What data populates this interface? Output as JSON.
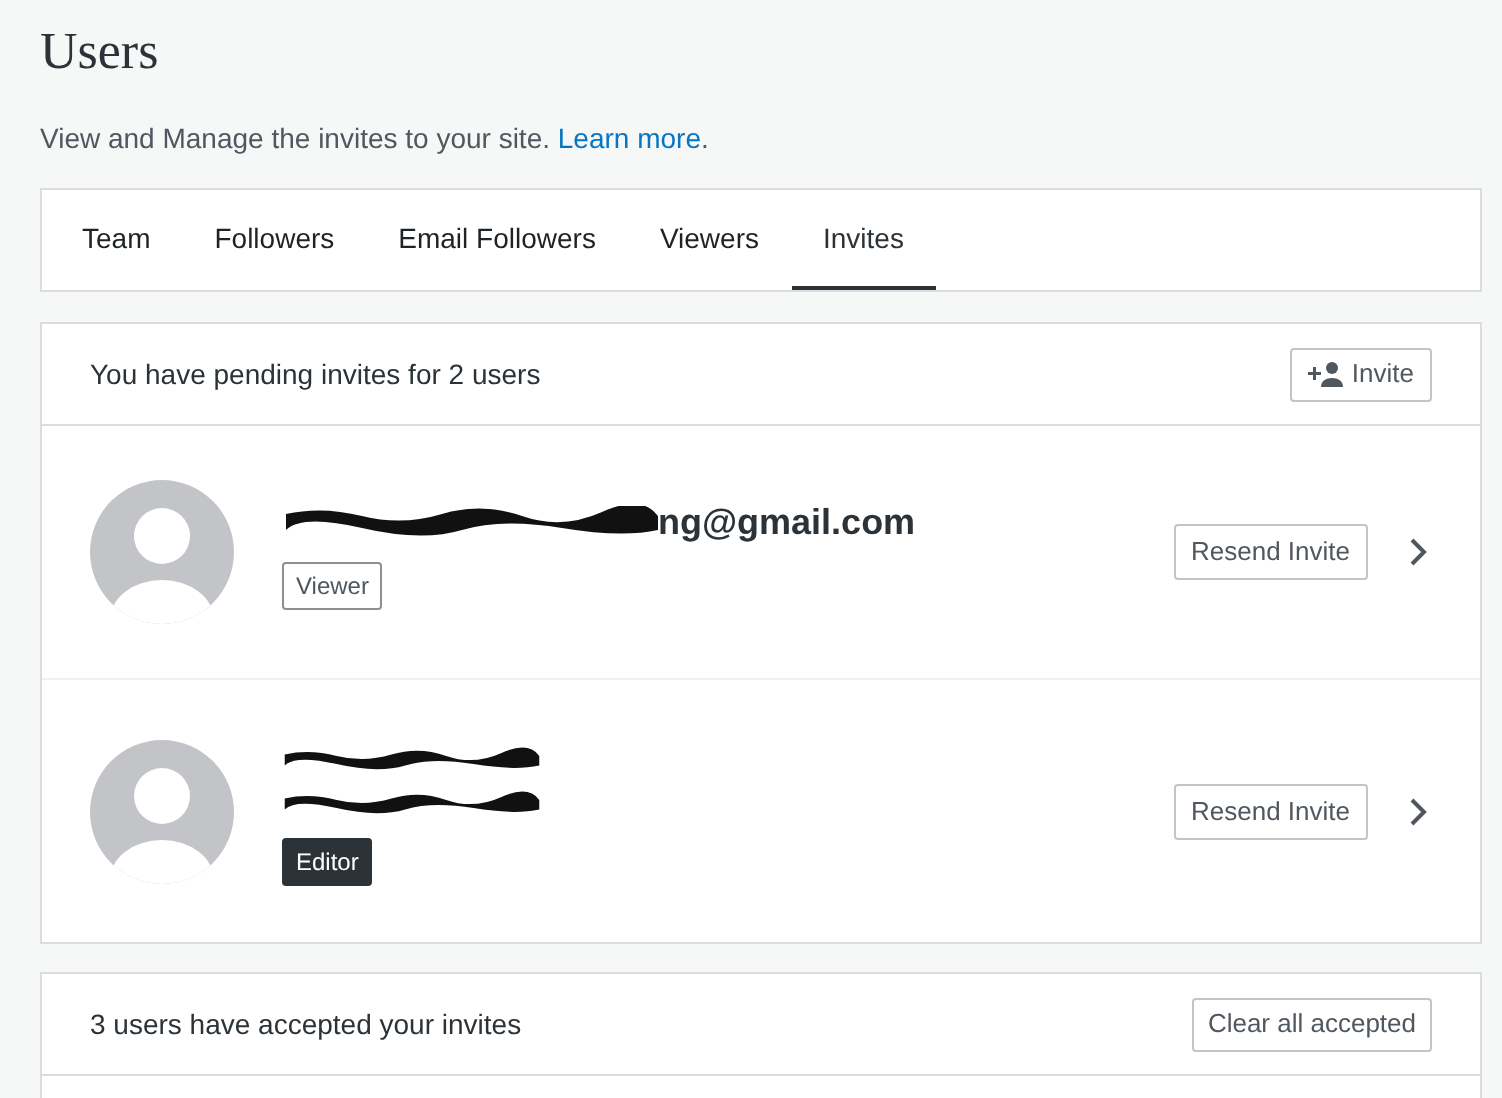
{
  "page": {
    "title": "Users",
    "subtitle": "View and Manage the invites to your site.",
    "link": "Learn more",
    "link_suffix": "."
  },
  "tabs": [
    {
      "label": "Team",
      "selected": false
    },
    {
      "label": "Followers",
      "selected": false
    },
    {
      "label": "Email Followers",
      "selected": false
    },
    {
      "label": "Viewers",
      "selected": false
    },
    {
      "label": "Invites",
      "selected": true
    }
  ],
  "pending": {
    "heading": "You have pending invites for 2 users",
    "button": "Invite",
    "invites": [
      {
        "lines": [
          {
            "kind": "partial",
            "text": "ng@gmail.com"
          }
        ],
        "role": {
          "text": "Viewer",
          "kind": "outline"
        },
        "action": "Resend Invite"
      },
      {
        "lines": [
          {
            "kind": "redacted"
          },
          {
            "kind": "redacted"
          }
        ],
        "role": {
          "text": "Editor",
          "kind": "filled"
        },
        "action": "Resend Invite"
      }
    ]
  },
  "accepted": {
    "heading": "3 users have accepted your invites",
    "button": "Clear all accepted"
  }
}
